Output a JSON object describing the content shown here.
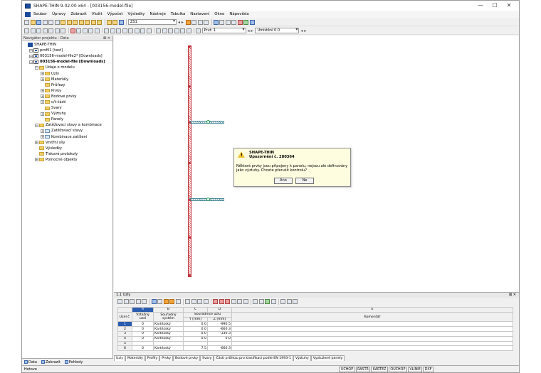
{
  "window": {
    "title": "SHAPE-THIN 9.02.00 x64 - [003156-model-file]"
  },
  "menu": [
    "Soubor",
    "Úpravy",
    "Zobrazit",
    "Vložit",
    "Výpočet",
    "Výsledky",
    "Nástroje",
    "Tabulka",
    "Nastavení",
    "Okno",
    "Nápověda"
  ],
  "toolbar": {
    "load_case": "ZS1",
    "member_label": "Prut: 1",
    "position_label": "Umístění 0.0"
  },
  "navigator": {
    "title": "Navigátor projektu - Data",
    "items": [
      {
        "label": "SHAPE-THIN",
        "level": 0,
        "kind": "app"
      },
      {
        "label": "profil1 [test]",
        "level": 1,
        "kind": "model"
      },
      {
        "label": "003156-model-file2* [Downloads]",
        "level": 1,
        "kind": "model"
      },
      {
        "label": "003156-model-file [Downloads]",
        "level": 1,
        "kind": "model",
        "bold": true
      },
      {
        "label": "Údaje o modelu",
        "level": 2,
        "kind": "folder"
      },
      {
        "label": "Uzly",
        "level": 3,
        "kind": "folder"
      },
      {
        "label": "Materiály",
        "level": 3,
        "kind": "folder"
      },
      {
        "label": "Průřezy",
        "level": 3,
        "kind": "folder"
      },
      {
        "label": "Prvky",
        "level": 3,
        "kind": "folder"
      },
      {
        "label": "Bodové prvky",
        "level": 3,
        "kind": "folder"
      },
      {
        "label": "c/t-části",
        "level": 3,
        "kind": "folder"
      },
      {
        "label": "Svary",
        "level": 3,
        "kind": "folder"
      },
      {
        "label": "Výztuhy",
        "level": 3,
        "kind": "folder"
      },
      {
        "label": "Panely",
        "level": 3,
        "kind": "folder"
      },
      {
        "label": "Zatěžovací stavy a kombinace",
        "level": 2,
        "kind": "folder"
      },
      {
        "label": "Zatěžovací stavy",
        "level": 3,
        "kind": "link"
      },
      {
        "label": "Kombinace zatížení",
        "level": 3,
        "kind": "link"
      },
      {
        "label": "Vnitřní síly",
        "level": 2,
        "kind": "folder"
      },
      {
        "label": "Výsledky",
        "level": 2,
        "kind": "folder"
      },
      {
        "label": "Tiskové protokoly",
        "level": 2,
        "kind": "folder"
      },
      {
        "label": "Pomocné objekty",
        "level": 2,
        "kind": "folder"
      }
    ],
    "tabs": [
      "Data",
      "Zobrazit",
      "Pohledy"
    ]
  },
  "dialog": {
    "app": "SHAPE-THIN",
    "subtitle": "Upozornění č. 280364",
    "message": "Některé prvky jsou připojeny k panelu, nejsou ale definovány jako výztuhy. Chcete přerušit kontrolu?",
    "yes": "Ano",
    "no": "Ne"
  },
  "table": {
    "title": "1.1 Uzly",
    "col_letters": [
      "A",
      "B",
      "C",
      "D",
      "E"
    ],
    "headers": {
      "node_no": "Uzel č.",
      "ref_node": "Vztažný uzel",
      "coord_system": "Souřadný systém",
      "coords": "Souřadnice uzlu",
      "y": "Y [mm]",
      "z": "Z [mm]",
      "comment": "Komentář"
    },
    "rows": [
      {
        "no": "1",
        "ref": "0",
        "sys": "Kartézský",
        "y": "0.0",
        "z": "-990.5"
      },
      {
        "no": "2",
        "ref": "0",
        "sys": "Kartézský",
        "y": "0.0",
        "z": "-660.3"
      },
      {
        "no": "3",
        "ref": "0",
        "sys": "Kartézský",
        "y": "0.0",
        "z": "-330.3"
      },
      {
        "no": "4",
        "ref": "0",
        "sys": "Kartézský",
        "y": "0.0",
        "z": "0.0"
      },
      {
        "no": "5",
        "ref": "",
        "sys": "",
        "y": "",
        "z": ""
      },
      {
        "no": "6",
        "ref": "0",
        "sys": "Kartézský",
        "y": "7.5",
        "z": "-660.3"
      }
    ]
  },
  "bottom_tabs": [
    "Uzly",
    "Materiály",
    "Profily",
    "Prvky",
    "Bodové prvky",
    "Svary",
    "Části průřezu pro klasifikaci podle EN 1993-1",
    "Výztuhy",
    "Vyztužené panely"
  ],
  "status": {
    "text": "Hotovo",
    "buttons": [
      "UCHOP",
      "RASTR",
      "KARTEZ",
      "OUCHOP",
      "VLINIE",
      "DXF"
    ]
  }
}
